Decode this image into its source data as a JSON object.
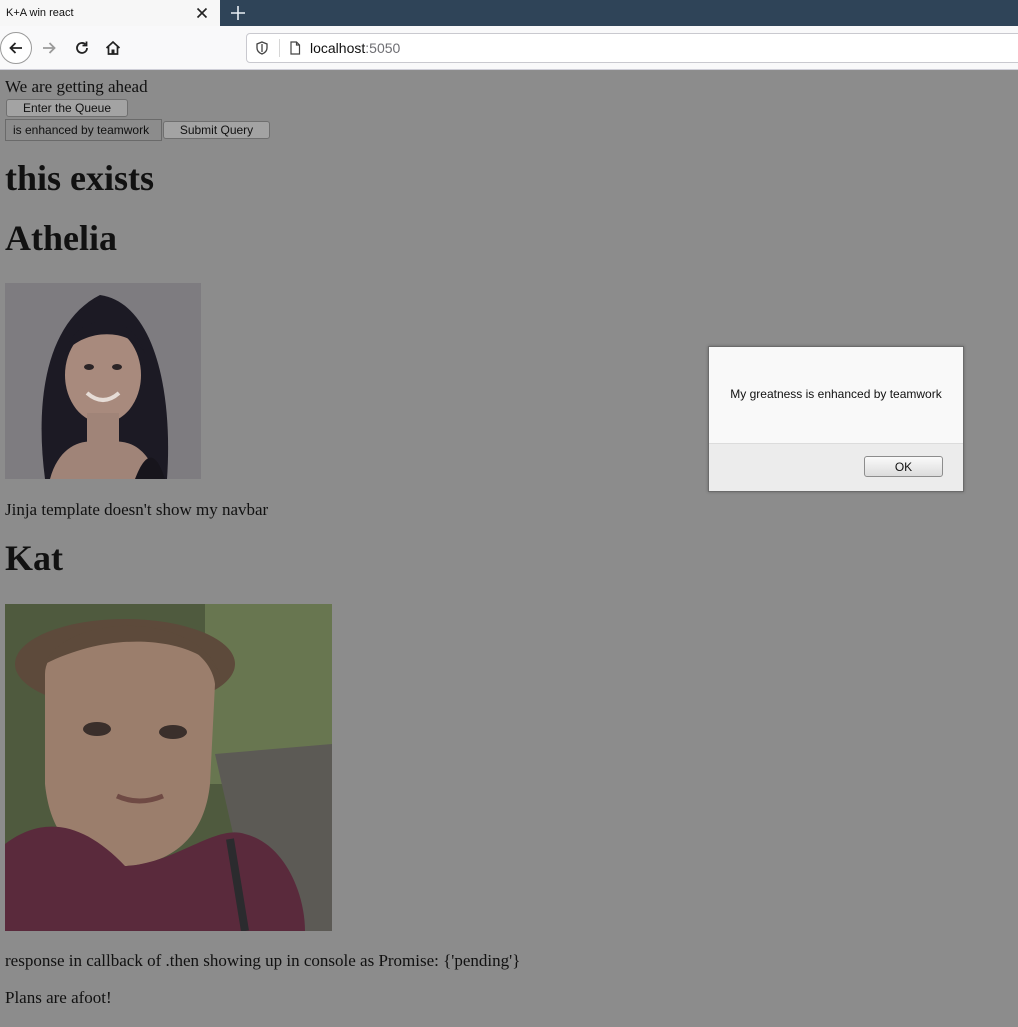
{
  "browser": {
    "tab_title": "K+A win react",
    "url_host": "localhost",
    "url_port": ":5050",
    "icons": [
      "close-icon",
      "new-tab-icon",
      "back-arrow-icon",
      "forward-arrow-icon",
      "reload-icon",
      "home-icon",
      "shield-icon",
      "page-icon"
    ]
  },
  "page": {
    "top_text": "We are getting ahead",
    "queue_button": "Enter the Queue",
    "input_value": "is enhanced by teamwork",
    "submit_button": "Submit Query",
    "heading_exists": "this exists",
    "athelia": {
      "name": "Athelia",
      "note": "Jinja template doesn't show my navbar"
    },
    "kat": {
      "name": "Kat",
      "note": "response in callback of .then showing up in console as Promise: {'pending'}"
    },
    "footer_text": "Plans are afoot!"
  },
  "alert": {
    "message": "My greatness is enhanced by teamwork",
    "ok_label": "OK"
  },
  "colors": {
    "overlay_gray": "#8c8c8c",
    "tabbar": "#2f4458"
  }
}
